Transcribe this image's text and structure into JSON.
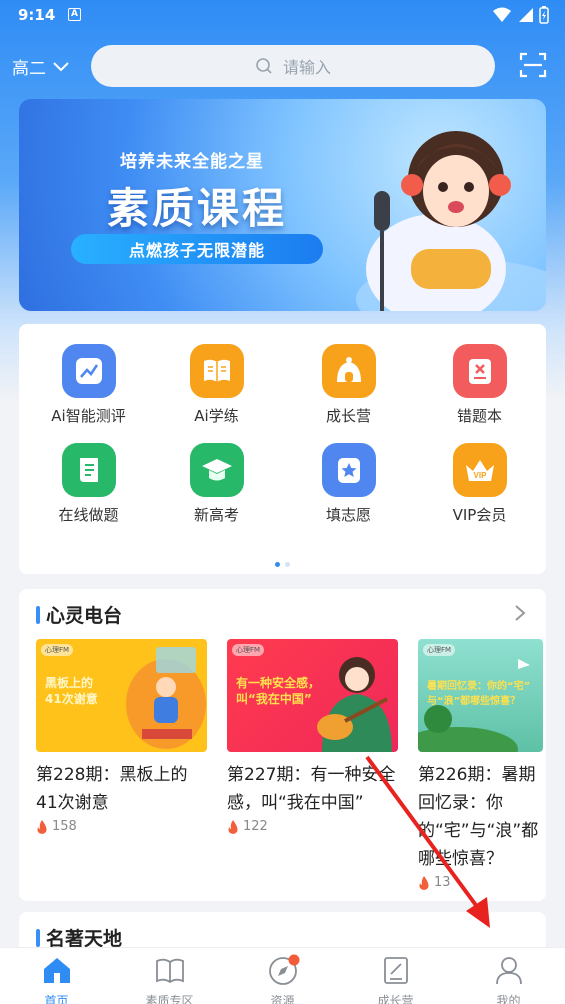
{
  "status_bar": {
    "time": "9:14",
    "notif_letter": "A"
  },
  "header": {
    "grade": "高二",
    "search_placeholder": "请输入"
  },
  "banner": {
    "subtitle": "培养未来全能之星",
    "title": "素质课程",
    "pill": "点燃孩子无限潜能"
  },
  "grid": [
    {
      "label": "Ai智能测评",
      "icon": "chart-trend-icon",
      "color": "#4f86f0"
    },
    {
      "label": "Ai学练",
      "icon": "book-open-icon",
      "color": "#f7a21a"
    },
    {
      "label": "成长营",
      "icon": "camp-tent-icon",
      "color": "#f7a21a"
    },
    {
      "label": "错题本",
      "icon": "error-book-icon",
      "color": "#f25c5c"
    },
    {
      "label": "在线做题",
      "icon": "scroll-icon",
      "color": "#27b86a"
    },
    {
      "label": "新高考",
      "icon": "graduation-cap-icon",
      "color": "#27b86a"
    },
    {
      "label": "填志愿",
      "icon": "star-badge-icon",
      "color": "#4f86f0"
    },
    {
      "label": "VIP会员",
      "icon": "vip-crown-icon",
      "color": "#f7a21a"
    }
  ],
  "radio": {
    "title": "心灵电台",
    "episodes": [
      {
        "name": "第228期：黑板上的41次谢意",
        "hot": "158",
        "thumb_tag": "心理FM",
        "thumb_text": "黑板上的\n41次谢意",
        "thumb_color": "#ffc21a"
      },
      {
        "name": "第227期：有一种安全感，叫“我在中国”",
        "hot": "122",
        "thumb_tag": "心理FM",
        "thumb_text": "有一种安全感，\n叫“我在中国”",
        "thumb_color": "#f2404f"
      },
      {
        "name": "第226期：暑期回忆录：你的“宅”与“浪”都哪些惊喜？",
        "hot": "13",
        "thumb_tag": "心理FM",
        "thumb_text": "暑期回忆录：你的“宅”\n与“浪”都哪些惊喜？",
        "thumb_color": "#7fd3c0"
      }
    ]
  },
  "books": {
    "title": "名著天地"
  },
  "tabs": [
    {
      "label": "首页",
      "icon": "home-icon",
      "active": true
    },
    {
      "label": "素质专区",
      "icon": "book-icon",
      "active": false
    },
    {
      "label": "资源",
      "icon": "compass-icon",
      "active": false
    },
    {
      "label": "成长营",
      "icon": "notebook-pen-icon",
      "active": false
    },
    {
      "label": "我的",
      "icon": "user-icon",
      "active": false
    }
  ],
  "colors": {
    "accent": "#2f8cf5",
    "arrow": "#e8231f"
  }
}
